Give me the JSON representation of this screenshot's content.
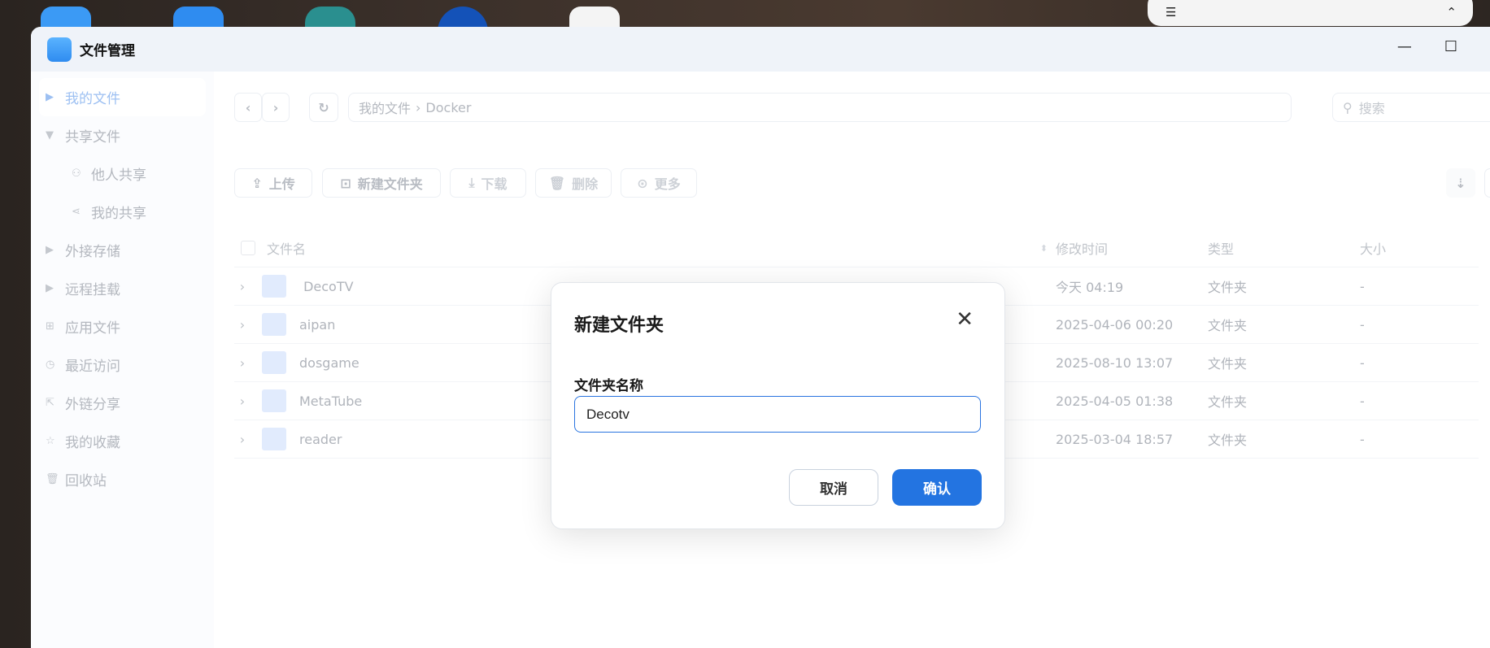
{
  "app": {
    "title": "文件管理"
  },
  "sidebar": {
    "items": [
      {
        "label": "我的文件",
        "icon": "caret-right-icon"
      },
      {
        "label": "共享文件",
        "icon": "caret-down-icon"
      },
      {
        "label": "他人共享",
        "icon": "users-icon"
      },
      {
        "label": "我的共享",
        "icon": "share-icon"
      },
      {
        "label": "外接存储",
        "icon": "caret-right-icon"
      },
      {
        "label": "远程挂载",
        "icon": "caret-right-icon"
      },
      {
        "label": "应用文件",
        "icon": "apps-icon"
      },
      {
        "label": "最近访问",
        "icon": "clock-icon"
      },
      {
        "label": "外链分享",
        "icon": "external-share-icon"
      },
      {
        "label": "我的收藏",
        "icon": "star-icon"
      },
      {
        "label": "回收站",
        "icon": "trash-icon"
      }
    ]
  },
  "nav": {
    "path_root": "我的文件",
    "path_sep": "›",
    "path_current": "Docker",
    "search_placeholder": "搜索"
  },
  "toolbar": {
    "upload": "上传",
    "new_folder": "新建文件夹",
    "download": "下载",
    "delete": "删除",
    "more": "更多"
  },
  "table": {
    "headers": {
      "name": "文件名",
      "time": "修改时间",
      "type": "类型",
      "size": "大小"
    },
    "rows": [
      {
        "name": " DecoTV",
        "time": "今天 04:19",
        "type": "文件夹",
        "size": "-"
      },
      {
        "name": "aipan",
        "time": "2025-04-06 00:20",
        "type": "文件夹",
        "size": "-"
      },
      {
        "name": "dosgame",
        "time": "2025-08-10 13:07",
        "type": "文件夹",
        "size": "-"
      },
      {
        "name": "MetaTube",
        "time": "2025-04-05 01:38",
        "type": "文件夹",
        "size": "-"
      },
      {
        "name": "reader",
        "time": "2025-03-04 18:57",
        "type": "文件夹",
        "size": "-"
      }
    ]
  },
  "dialog": {
    "title": "新建文件夹",
    "field_label": "文件夹名称",
    "field_value": "Decotv",
    "cancel": "取消",
    "confirm": "确认"
  },
  "colors": {
    "accent": "#2374e1"
  }
}
